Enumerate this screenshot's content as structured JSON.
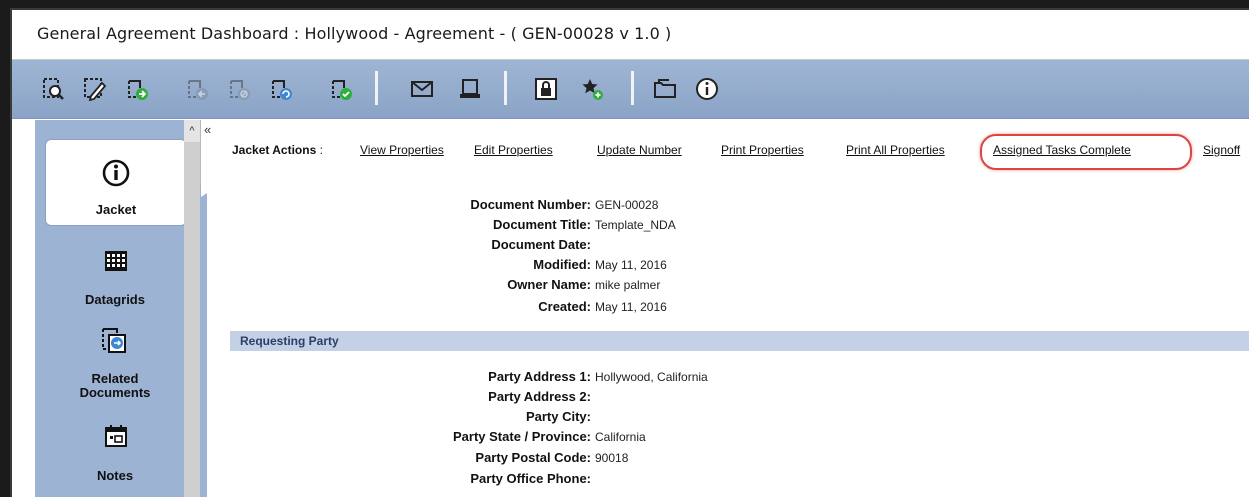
{
  "window": {
    "title": "General Agreement  Dashboard : Hollywood - Agreement - ( GEN-00028 v 1.0 )"
  },
  "toolbar": {
    "icons": [
      "view-icon",
      "edit-icon",
      "check-out-icon",
      "check-in-icon",
      "cancel-checkout-icon",
      "update-version-icon",
      "approve-icon",
      "email-icon",
      "print-icon",
      "lock-icon",
      "favorite-icon",
      "folder-icon",
      "info-icon"
    ]
  },
  "sidebar": {
    "items": [
      {
        "label": "Jacket",
        "icon": "info-circle-icon"
      },
      {
        "label": "Datagrids",
        "icon": "grid-icon"
      },
      {
        "label": "Related Documents",
        "icon": "related-docs-icon"
      },
      {
        "label": "Notes",
        "icon": "calendar-notes-icon"
      }
    ],
    "collapse_glyph": "«",
    "scroll_up_glyph": "^"
  },
  "actions": {
    "prefix": "Jacket Actions",
    "separator": ":",
    "links": [
      "View Properties",
      "Edit Properties",
      "Update Number",
      "Print Properties",
      "Print All Properties",
      "Assigned Tasks Complete",
      "Signoff"
    ],
    "highlight_color": "#d9463f"
  },
  "document": {
    "fields": [
      {
        "label": "Document Number:",
        "value": "GEN-00028"
      },
      {
        "label": "Document Title:",
        "value": "Template_NDA"
      },
      {
        "label": "Document Date:",
        "value": ""
      },
      {
        "label": "Modified:",
        "value": "May 11, 2016"
      },
      {
        "label": "Owner Name:",
        "value": "mike palmer"
      },
      {
        "label": "Created:",
        "value": "May 11, 2016"
      }
    ]
  },
  "requesting_party": {
    "title": "Requesting Party",
    "fields": [
      {
        "label": "Party Address 1:",
        "value": "Hollywood, California"
      },
      {
        "label": "Party Address 2:",
        "value": ""
      },
      {
        "label": "Party City:",
        "value": ""
      },
      {
        "label": "Party State / Province:",
        "value": "California"
      },
      {
        "label": "Party Postal Code:",
        "value": "90018"
      },
      {
        "label": "Party Office Phone:",
        "value": ""
      }
    ]
  },
  "colors": {
    "toolbar": "#8fa7c9",
    "sidebar": "#9cb3d3",
    "section_bar": "#c4d0e6",
    "green_accent": "#2fae3c"
  }
}
